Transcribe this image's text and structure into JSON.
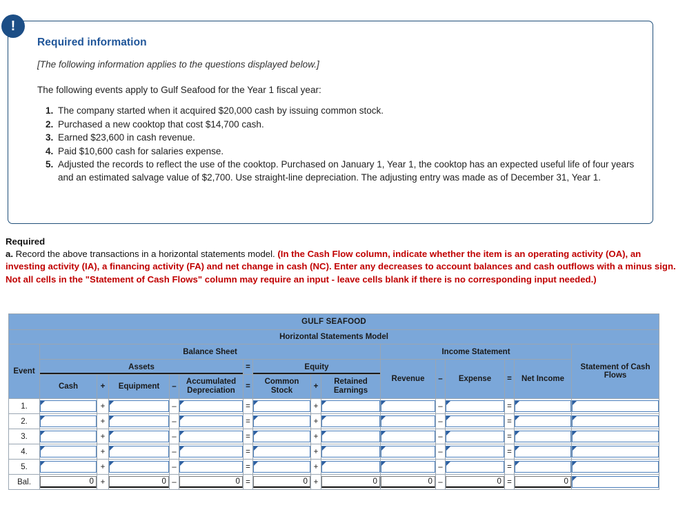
{
  "callout": {
    "icon": "exclamation-icon",
    "icon_glyph": "!",
    "title": "Required information",
    "italic_note": "[The following information applies to the questions displayed below.]",
    "lead": "The following events apply to Gulf Seafood for the Year 1 fiscal year:",
    "events": [
      {
        "num": "1.",
        "text": "The company started when it acquired $20,000 cash by issuing common stock."
      },
      {
        "num": "2.",
        "text": "Purchased a new cooktop that cost $14,700 cash."
      },
      {
        "num": "3.",
        "text": "Earned $23,600 in cash revenue."
      },
      {
        "num": "4.",
        "text": "Paid $10,600 cash for salaries expense."
      },
      {
        "num": "5.",
        "text": "Adjusted the records to reflect the use of the cooktop. Purchased on January 1, Year 1, the cooktop has an expected useful life of four years and an estimated salvage value of $2,700. Use straight-line depreciation. The adjusting entry was made as of December 31, Year 1."
      }
    ]
  },
  "required": {
    "heading": "Required",
    "item_label": "a.",
    "item_text": " Record the above transactions in a horizontal statements model. ",
    "red_text": "(In the Cash Flow column, indicate whether the item is an operating activity (OA), an investing activity (IA), a financing activity (FA) and net change in cash (NC). Enter any decreases to account balances and cash outflows with a minus sign. Not all cells in the \"Statement of Cash Flows\" column may require an input - leave cells blank if there is no corresponding input needed.)",
    "red_color": "#C00000"
  },
  "sheet": {
    "company": "GULF SEAFOOD",
    "subtitle": "Horizontal Statements Model",
    "groups": {
      "balance_sheet": "Balance Sheet",
      "income_statement": "Income Statement",
      "assets": "Assets",
      "equity": "Equity",
      "cash_flows": "Statement of Cash Flows"
    },
    "event_header": "Event",
    "columns": {
      "cash": "Cash",
      "equipment": "Equipment",
      "accumulated_depreciation": "Accumulated Depreciation",
      "common_stock": "Common Stock",
      "retained_earnings": "Retained Earnings",
      "revenue": "Revenue",
      "expense": "Expense",
      "net_income": "Net Income"
    },
    "operators": {
      "plus": "+",
      "minus": "–",
      "equals": "="
    },
    "rows": [
      {
        "label": "1."
      },
      {
        "label": "2."
      },
      {
        "label": "3."
      },
      {
        "label": "4."
      },
      {
        "label": "5."
      }
    ],
    "balance_row": {
      "label": "Bal.",
      "cash": "0",
      "equipment": "0",
      "accumulated_depreciation": "0",
      "common_stock": "0",
      "retained_earnings": "0",
      "revenue": "0",
      "expense": "0",
      "net_income": "0",
      "cash_flows": ""
    },
    "header_bg": "#7BA7D9",
    "input_border": "#4A7EBB"
  }
}
